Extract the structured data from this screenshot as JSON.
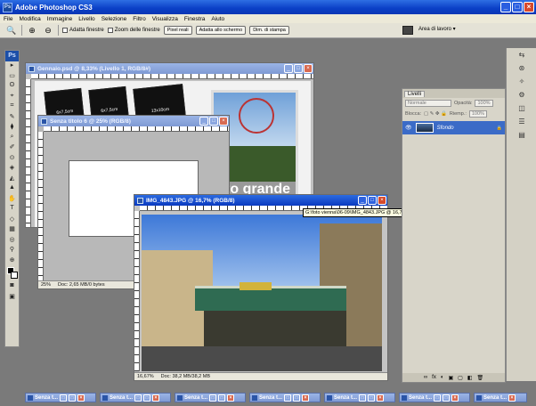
{
  "app": {
    "title": "Adobe Photoshop CS3",
    "logo": "Ps"
  },
  "window_buttons": {
    "minimize": "_",
    "maximize": "□",
    "close": "×"
  },
  "menu": [
    "File",
    "Modifica",
    "Immagine",
    "Livello",
    "Selezione",
    "Filtro",
    "Visualizza",
    "Finestra",
    "Aiuto"
  ],
  "options": {
    "check_fit_windows": "Adatta finestre",
    "check_zoom_all": "Zoom delle finestre",
    "btn_actual_pixels": "Pixel reali",
    "btn_fit_screen": "Adatta allo schermo",
    "btn_print_size": "Dim. di stampa",
    "workspace": "Area di lavoro ▾"
  },
  "toolbox": {
    "logo": "Ps",
    "tools": [
      "▸",
      "▭",
      "ʘ",
      "⌖",
      "⌗",
      "✎",
      "⧫",
      "⌕",
      "✐",
      "⊙",
      "◈",
      "◭",
      "▲",
      "✋",
      "T",
      "◇",
      "▦",
      "◎",
      "⚲",
      "⊕"
    ]
  },
  "doc_gennaio": {
    "title": "Gennaio.psd @ 8,33% (Livello 1, RGB/8#)",
    "cards": [
      "6x7,5cm",
      "6x7,5cm",
      "13x10cm"
    ],
    "overlay_text": "foto grande"
  },
  "doc_untitled": {
    "title": "Senza titolo 6 @ 25% (RGB/8)",
    "zoom": "25%",
    "doc_info": "Doc: 2,65 MB/0 bytes"
  },
  "doc_img": {
    "title": "IMG_4843.JPG @ 16,7% (RGB/8)",
    "zoom": "16,67%",
    "doc_info": "Doc: 38,2 MB/38,2 MB"
  },
  "tooltip": "G:\\foto vienna\\06-09\\IMG_4843.JPG @ 16,7% (RGB/8)",
  "layers": {
    "tab": "Livelli",
    "blend": "Normale",
    "opacity_label": "Opacità:",
    "opacity": "100%",
    "lock_label": "Blocca:",
    "fill_label": "Riemp.:",
    "fill": "100%",
    "layer_name": "Sfondo",
    "layer_eye": "👁",
    "layer_lock": "🔒",
    "footer_icons": [
      "∞",
      "fx",
      "◐",
      "▣",
      "▢",
      "◧",
      "🗑"
    ]
  },
  "minimized": [
    "Senza t...",
    "Senza t...",
    "Senza t...",
    "Senza t...",
    "Senza t...",
    "Senza t...",
    "Senza t..."
  ],
  "dock_icons": [
    "⇆",
    "⊛",
    "✧",
    "⚙",
    "◫",
    "☰",
    "▤"
  ]
}
